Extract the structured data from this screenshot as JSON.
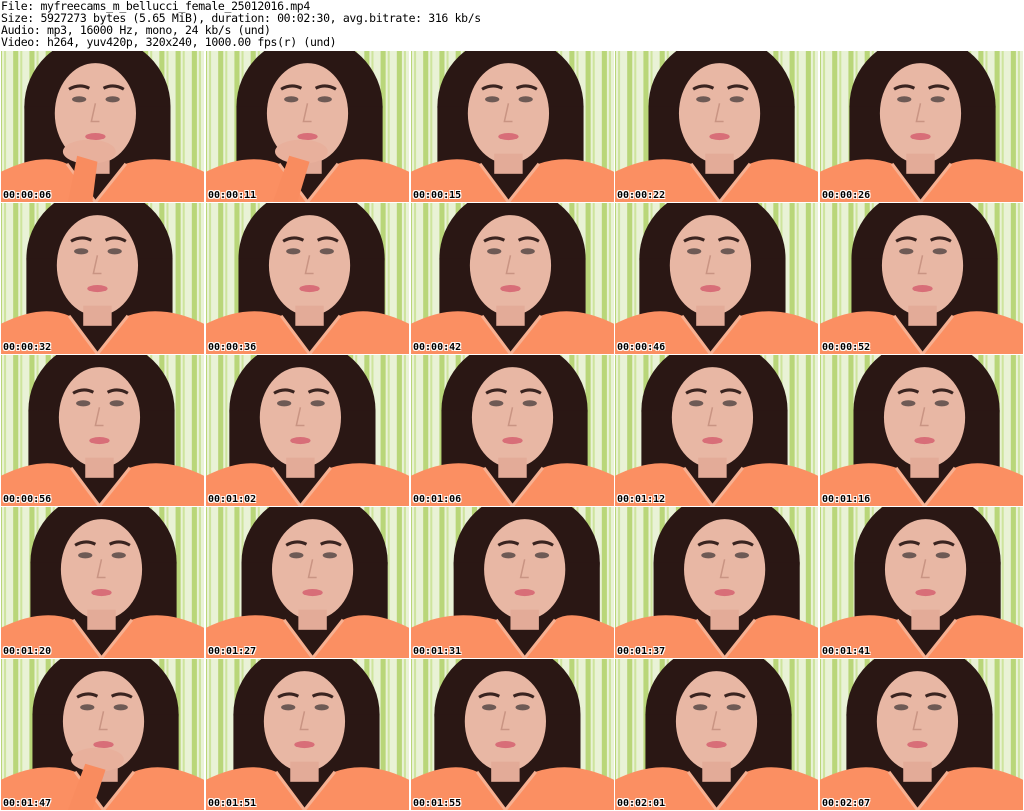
{
  "header": {
    "file_line": "File: myfreecams_m_bellucci_female_25012016.mp4",
    "size_line": "Size: 5927273 bytes (5.65 MiB), duration: 00:02:30, avg.bitrate: 316 kb/s",
    "audio_line": "Audio: mp3, 16000 Hz, mono, 24 kb/s (und)",
    "video_line": "Video: h264, yuv420p, 320x240, 1000.00 fps(r) (und)"
  },
  "thumbnails": [
    {
      "time": "00:00:06"
    },
    {
      "time": "00:00:11"
    },
    {
      "time": "00:00:15"
    },
    {
      "time": "00:00:22"
    },
    {
      "time": "00:00:26"
    },
    {
      "time": "00:00:32"
    },
    {
      "time": "00:00:36"
    },
    {
      "time": "00:00:42"
    },
    {
      "time": "00:00:46"
    },
    {
      "time": "00:00:52"
    },
    {
      "time": "00:00:56"
    },
    {
      "time": "00:01:02"
    },
    {
      "time": "00:01:06"
    },
    {
      "time": "00:01:12"
    },
    {
      "time": "00:01:16"
    },
    {
      "time": "00:01:20"
    },
    {
      "time": "00:01:27"
    },
    {
      "time": "00:01:31"
    },
    {
      "time": "00:01:37"
    },
    {
      "time": "00:01:41"
    },
    {
      "time": "00:01:47"
    },
    {
      "time": "00:01:51"
    },
    {
      "time": "00:01:55"
    },
    {
      "time": "00:02:01"
    },
    {
      "time": "00:02:07"
    }
  ]
}
